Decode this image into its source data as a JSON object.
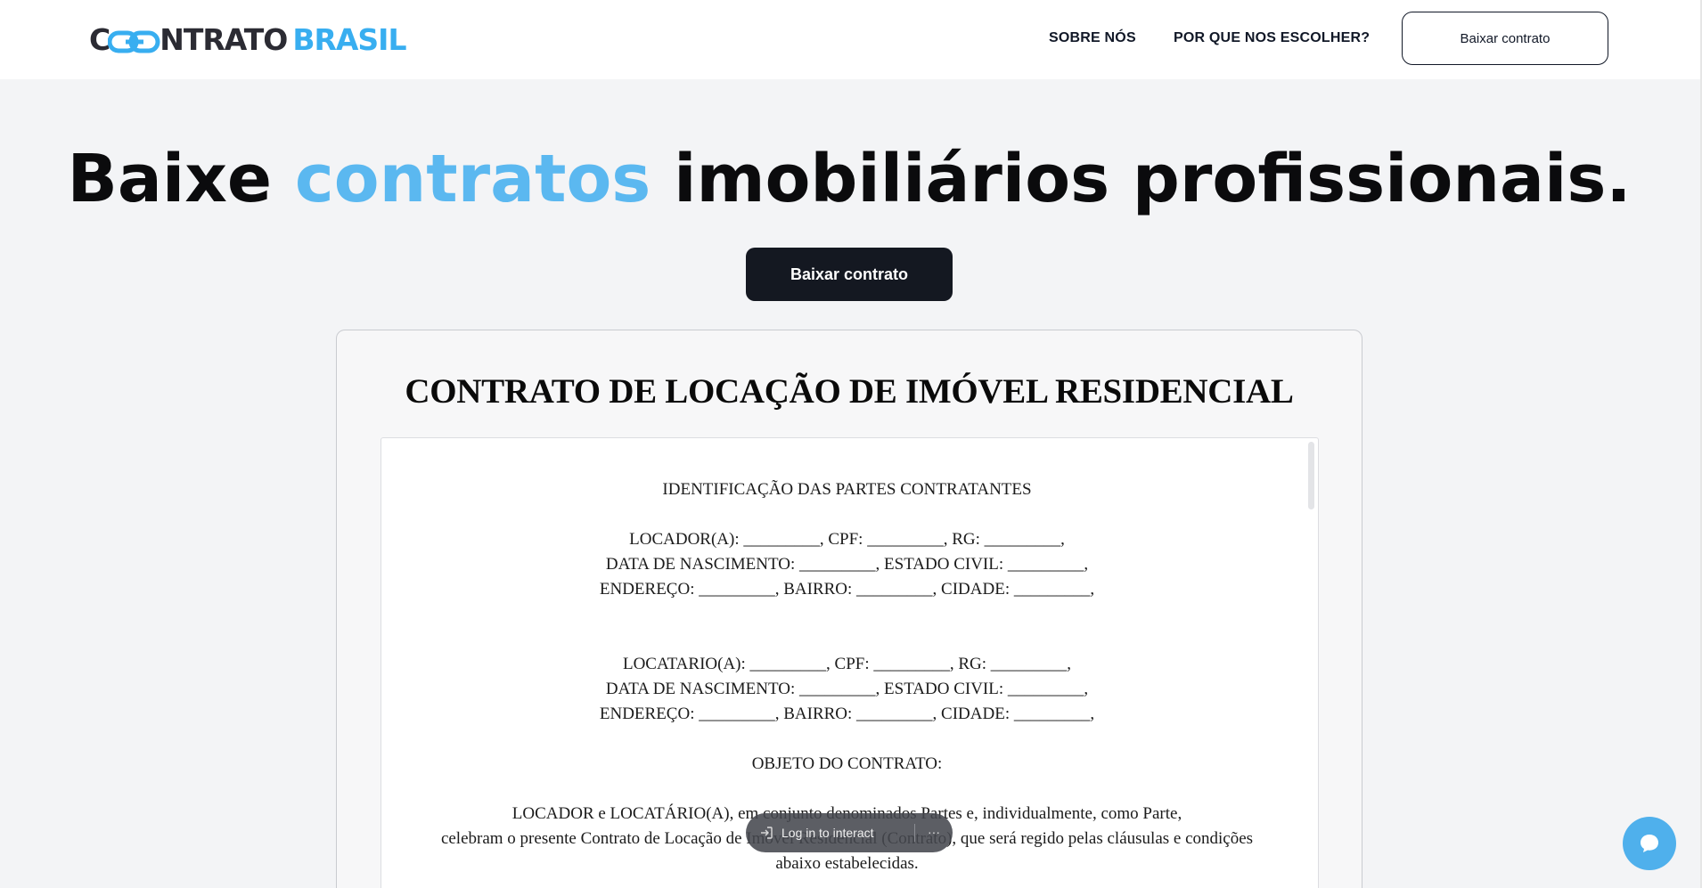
{
  "header": {
    "logo": {
      "part1": "C",
      "part2": "NTRATO",
      "part3": "BRASIL",
      "color_dark": "#2b2b33",
      "color_accent": "#38aef0",
      "icon": "chain-link-icon"
    },
    "nav": {
      "about": "SOBRE NÓS",
      "why": "POR QUE NOS ESCOLHER?"
    },
    "download_button": "Baixar contrato"
  },
  "hero": {
    "title_start": "Baixe ",
    "title_accent": "contratos",
    "title_end": " imobiliários profissionais.",
    "accent_color": "#5bb8f0",
    "button": "Baixar contrato"
  },
  "contract": {
    "title": "CONTRATO DE LOCAÇÃO DE IMÓVEL RESIDENCIAL",
    "lines": {
      "section1": "IDENTIFICAÇÃO DAS PARTES CONTRATANTES",
      "locador1": "LOCADOR(A): _________, CPF: _________, RG: _________,",
      "locador2": "DATA DE NASCIMENTO: _________, ESTADO CIVIL: _________,",
      "locador3": "ENDEREÇO: _________, BAIRRO: _________, CIDADE: _________,",
      "locatario1": "LOCATARIO(A): _________, CPF: _________, RG: _________,",
      "locatario2": "DATA DE NASCIMENTO: _________, ESTADO CIVIL: _________,",
      "locatario3": "ENDEREÇO: _________, BAIRRO: _________, CIDADE: _________,",
      "section2": "OBJETO DO CONTRATO:",
      "para1": "LOCADOR e LOCATÁRIO(A), em conjunto denominados Partes e, individualmente, como Parte,",
      "para2": "celebram o presente Contrato de Locação de Imóvel Residencial (Contrato), que será regido pelas cláusulas e condições",
      "para3": "abaixo estabelecidas."
    }
  },
  "overlay": {
    "login_label": "Log in to interact",
    "login_icon": "login-arrow-icon",
    "more_icon": "more-dots-icon"
  },
  "chat": {
    "icon": "chat-bubble-icon",
    "color": "#4fb0ec"
  }
}
